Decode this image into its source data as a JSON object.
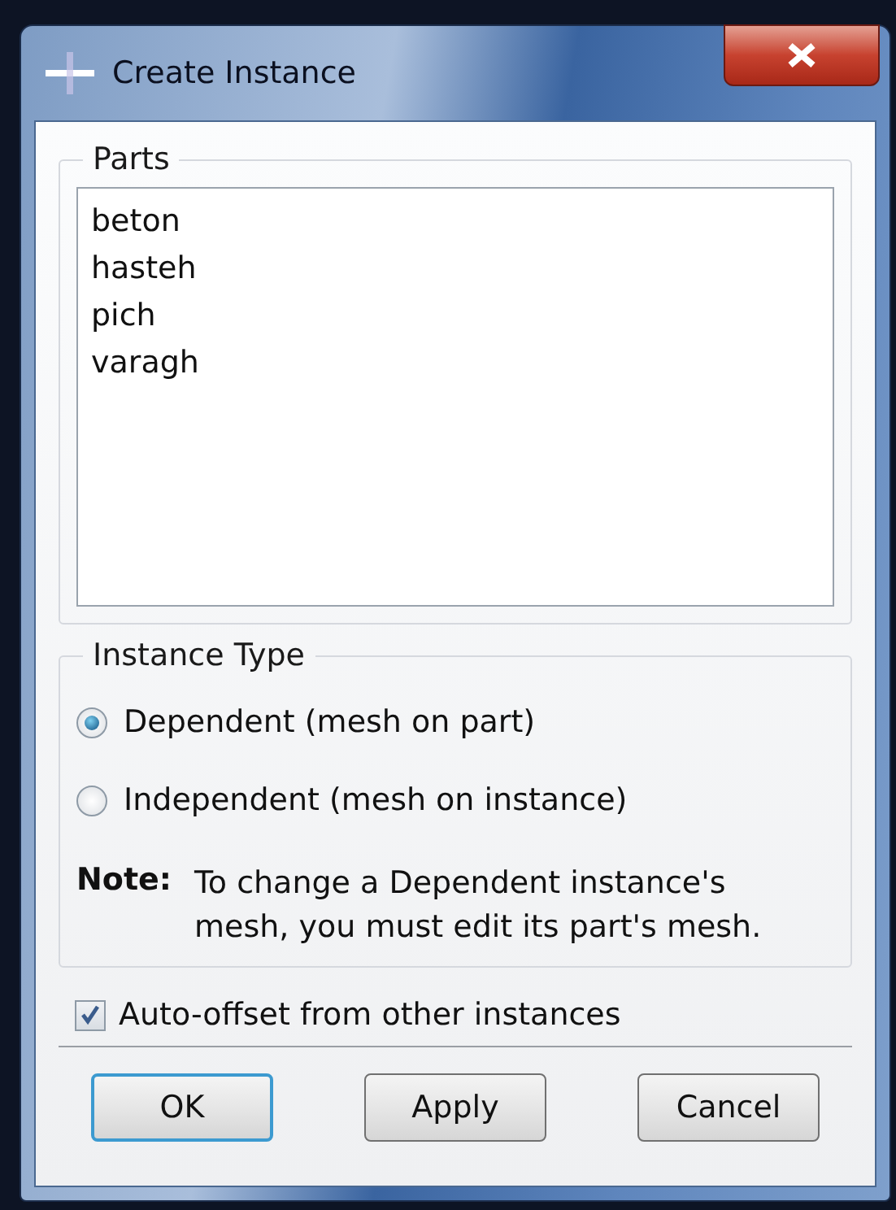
{
  "window": {
    "title": "Create Instance"
  },
  "parts": {
    "title": "Parts",
    "items": [
      {
        "label": "beton",
        "selected": false
      },
      {
        "label": "hasteh",
        "selected": false
      },
      {
        "label": "pich",
        "selected": false
      },
      {
        "label": "varagh",
        "selected": false
      }
    ]
  },
  "instance_type": {
    "title": "Instance Type",
    "options": [
      {
        "label": "Dependent (mesh on part)",
        "selected": true
      },
      {
        "label": "Independent (mesh on instance)",
        "selected": false
      }
    ],
    "note_label": "Note:",
    "note": "To change a Dependent instance's mesh, you must edit its part's mesh."
  },
  "auto_offset": {
    "label": "Auto-offset from other instances",
    "checked": true
  },
  "buttons": [
    {
      "label": "OK",
      "default": true
    },
    {
      "label": "Apply",
      "default": false
    },
    {
      "label": "Cancel",
      "default": false
    }
  ]
}
